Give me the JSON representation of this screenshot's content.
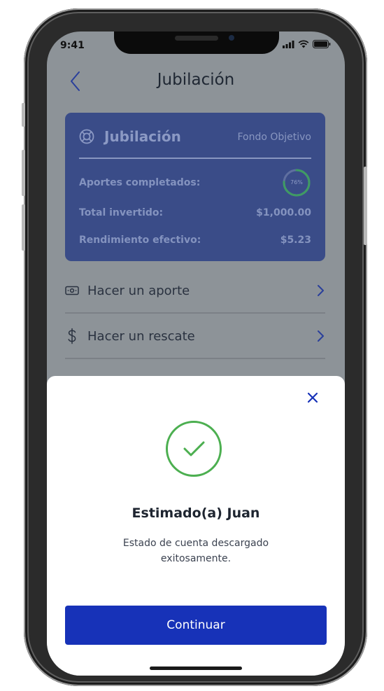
{
  "status_bar": {
    "time": "9:41"
  },
  "header": {
    "title": "Jubilación"
  },
  "card": {
    "title": "Jubilación",
    "subtitle": "Fondo Objetivo",
    "rows": [
      {
        "label": "Aportes completados:",
        "value": "76%",
        "progress": 0.76
      },
      {
        "label": "Total invertido:",
        "value": "$1,000.00"
      },
      {
        "label": "Rendimiento efectivo:",
        "value": "$5.23"
      }
    ]
  },
  "actions": [
    {
      "label": "Hacer un aporte",
      "icon": "cash-icon"
    },
    {
      "label": "Hacer un rescate",
      "icon": "dollar-icon"
    }
  ],
  "modal": {
    "title": "Estimado(a) Juan",
    "message": "Estado de cuenta descargado exitosamente.",
    "button_label": "Continuar"
  },
  "colors": {
    "accent": "#1732b8",
    "card": "#3a4c88",
    "success": "#4caf50",
    "overlay": "#8d9398"
  }
}
